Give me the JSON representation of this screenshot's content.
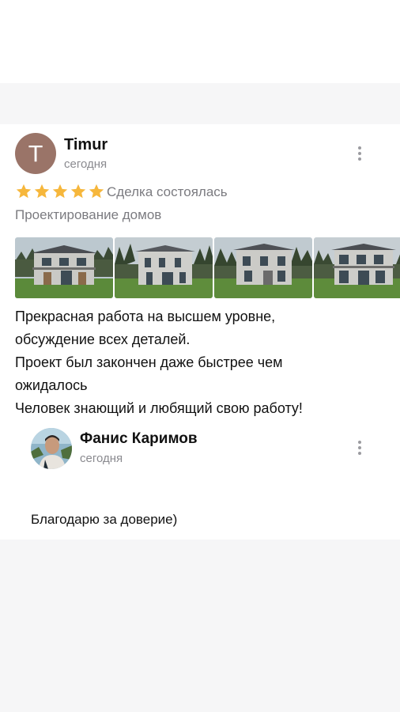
{
  "review": {
    "avatar_letter": "T",
    "author": "Timur",
    "date": "сегодня",
    "rating": 5,
    "deal_status": "Сделка состоялась",
    "service": "Проектирование домов",
    "photos": [
      {
        "icon": "house-photo-1"
      },
      {
        "icon": "house-photo-2"
      },
      {
        "icon": "house-photo-3"
      },
      {
        "icon": "house-photo-4"
      }
    ],
    "text_lines": [
      "Прекрасная работа на высшем уровне,",
      "обсуждение всех деталей.",
      "Проект был закончен даже быстрее чем",
      "ожидалось",
      "Человек знающий и любящий свою работу!"
    ]
  },
  "reply": {
    "author": "Фанис Каримов",
    "date": "сегодня",
    "text": "Благодарю за доверие)"
  },
  "colors": {
    "avatar_bg": "#9a7468",
    "star": "#f6b73c",
    "muted_text": "#7b7b80",
    "page_bg": "#f6f6f7"
  }
}
